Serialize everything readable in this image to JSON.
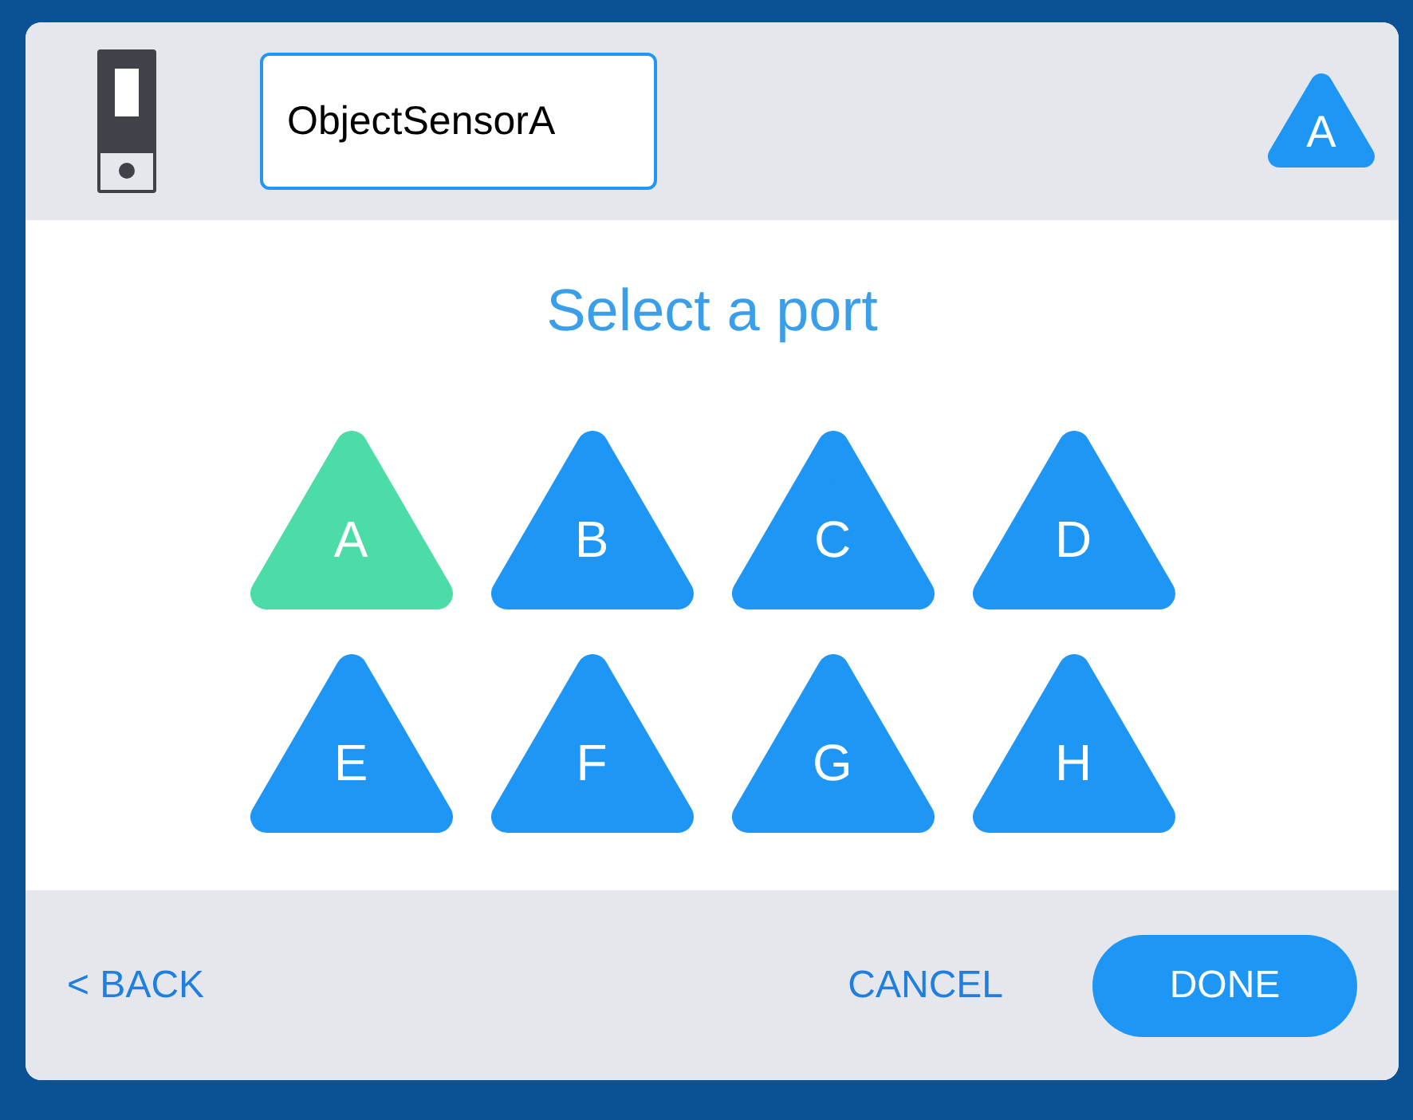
{
  "header": {
    "device_name": "ObjectSensorA",
    "current_port": "A"
  },
  "title": "Select a port",
  "ports": [
    {
      "label": "A",
      "selected": true
    },
    {
      "label": "B",
      "selected": false
    },
    {
      "label": "C",
      "selected": false
    },
    {
      "label": "D",
      "selected": false
    },
    {
      "label": "E",
      "selected": false
    },
    {
      "label": "F",
      "selected": false
    },
    {
      "label": "G",
      "selected": false
    },
    {
      "label": "H",
      "selected": false
    }
  ],
  "footer": {
    "back": "< BACK",
    "cancel": "CANCEL",
    "done": "DONE"
  }
}
